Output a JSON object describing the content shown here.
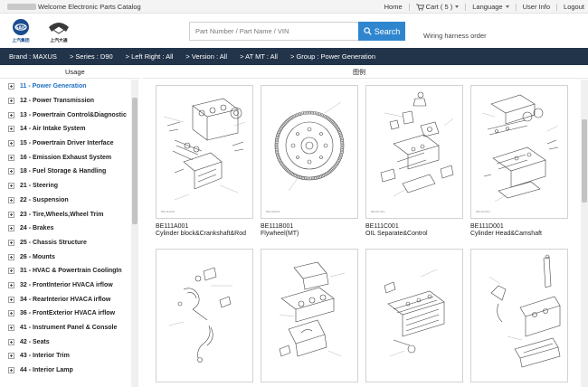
{
  "topbar": {
    "welcome": "Welcome Electronic Parts Catalog",
    "home": "Home",
    "cart": "Cart ( 5 )",
    "language": "Language",
    "user_info": "User Info",
    "logout": "Logout"
  },
  "header": {
    "saic_logo_text": "上汽集团",
    "maxus_logo_text": "上汽大通",
    "search_placeholder": "Part Number / Part Name / VIN",
    "search_button": "Search",
    "hot_link": "Wiring harness order",
    "accent_color": "#2f86cf"
  },
  "breadcrumb": [
    "Brand : MAXUS",
    "> Series : D90",
    "> Left Right : All",
    "> Version : All",
    "> AT MT : All",
    "> Group : Power Generation"
  ],
  "sidebar": {
    "title": "Usage",
    "items": [
      "11 - Power Generation",
      "12 - Power Transmission",
      "13 - Powertrain Control&Diagnostic",
      "14 - Air Intake System",
      "15 - Powertrain Driver Interface",
      "16 - Emission Exhaust System",
      "18 - Fuel Storage & Handling",
      "21 - Steering",
      "22 - Suspension",
      "23 - Tire,Wheels,Wheel Trim",
      "24 - Brakes",
      "25 - Chassis Structure",
      "26 - Mounts",
      "31 - HVAC & Powertrain CoolingIn",
      "32 - FrontInterior HVACA irflow",
      "34 - RearInterior HVACA irflow",
      "36 - FrontExterior HVACA irflow",
      "41 - Instrument Panel & Console",
      "42 - Seats",
      "43 - Interior Trim",
      "44 - Interior Lamp"
    ],
    "active_index": 0
  },
  "main": {
    "title": "图例",
    "cards": [
      {
        "code": "BE111A001",
        "name": "Cylinder block&Crankshaft&Rod",
        "icon": "engine-block-drawing"
      },
      {
        "code": "BE111B001",
        "name": "Flywheel(MT)",
        "icon": "flywheel-drawing"
      },
      {
        "code": "BE111C001",
        "name": "OIL Separate&Control",
        "icon": "oil-separator-drawing"
      },
      {
        "code": "BE111D001",
        "name": "Cylinder Head&Camshaft",
        "icon": "cylinder-head-drawing"
      },
      {
        "code": "",
        "name": "",
        "icon": "hose-drawing"
      },
      {
        "code": "",
        "name": "",
        "icon": "manifold-drawing"
      },
      {
        "code": "",
        "name": "",
        "icon": "intake-drawing"
      },
      {
        "code": "",
        "name": "",
        "icon": "oil-pan-drawing"
      }
    ]
  }
}
